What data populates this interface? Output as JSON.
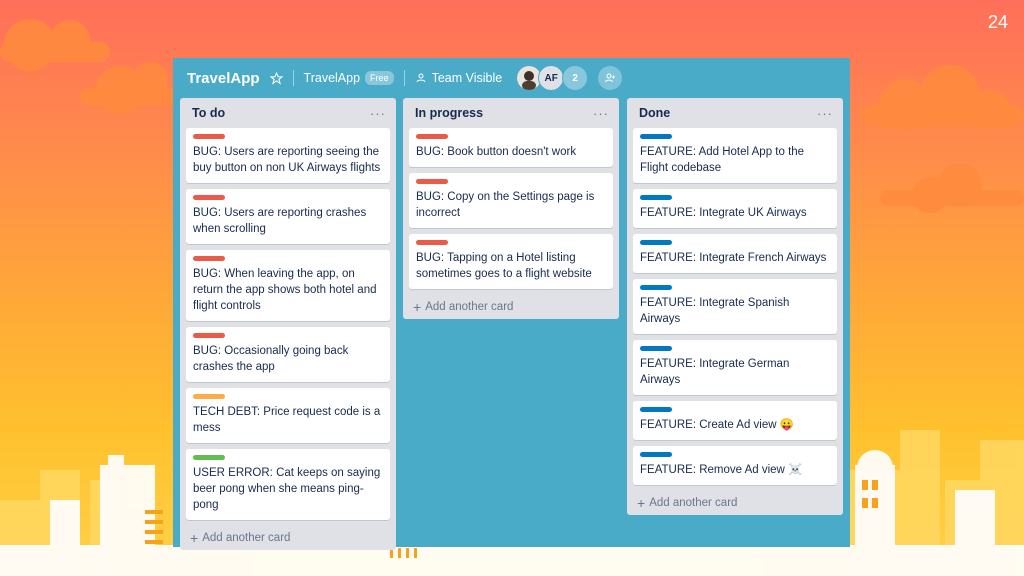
{
  "slide": {
    "page_number": "24"
  },
  "board": {
    "title": "TravelApp",
    "team_name": "TravelApp",
    "team_plan": "Free",
    "visibility": "Team Visible",
    "members": {
      "initials": "AF",
      "extra_count": "2"
    }
  },
  "colors": {
    "bug": "#eb5a46",
    "tech_debt": "#ffab4a",
    "user_error": "#61bd4f",
    "feature": "#0079bf",
    "board_bg": "#4aabc9"
  },
  "lists": [
    {
      "title": "To do",
      "menu": "···",
      "add_card": "Add another card",
      "cards": [
        {
          "label": "bug",
          "text": "BUG: Users are reporting seeing the buy button on non UK Airways flights"
        },
        {
          "label": "bug",
          "text": "BUG: Users are reporting crashes when scrolling"
        },
        {
          "label": "bug",
          "text": "BUG: When leaving the app, on return the app shows both hotel and flight controls"
        },
        {
          "label": "bug",
          "text": "BUG: Occasionally going back crashes the app"
        },
        {
          "label": "tech_debt",
          "text": "TECH DEBT: Price request code is a mess"
        },
        {
          "label": "user_error",
          "text": "USER ERROR: Cat keeps on saying beer pong when she means ping-pong"
        }
      ]
    },
    {
      "title": "In progress",
      "menu": "···",
      "add_card": "Add another card",
      "cards": [
        {
          "label": "bug",
          "text": "BUG: Book button doesn't work"
        },
        {
          "label": "bug",
          "text": "BUG: Copy on the Settings page is incorrect"
        },
        {
          "label": "bug",
          "text": "BUG: Tapping on a Hotel listing sometimes goes to a flight website"
        }
      ]
    },
    {
      "title": "Done",
      "menu": "···",
      "add_card": "Add another card",
      "cards": [
        {
          "label": "feature",
          "text": "FEATURE: Add Hotel App to the Flight codebase"
        },
        {
          "label": "feature",
          "text": "FEATURE: Integrate UK Airways"
        },
        {
          "label": "feature",
          "text": "FEATURE: Integrate French Airways"
        },
        {
          "label": "feature",
          "text": "FEATURE: Integrate Spanish Airways"
        },
        {
          "label": "feature",
          "text": "FEATURE: Integrate German Airways"
        },
        {
          "label": "feature",
          "text": "FEATURE: Create Ad view 😛"
        },
        {
          "label": "feature",
          "text": "FEATURE: Remove Ad view ☠️"
        }
      ]
    }
  ]
}
